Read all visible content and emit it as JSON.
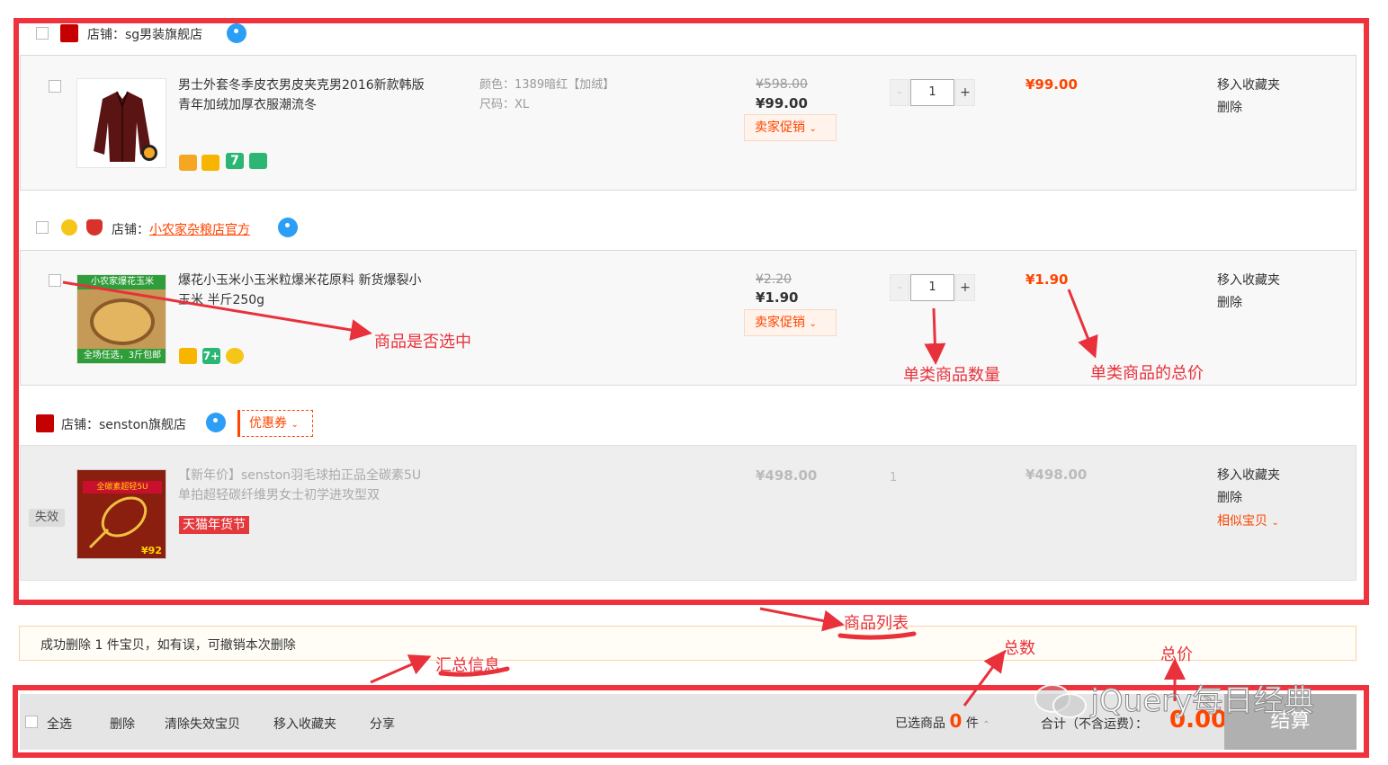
{
  "shops": [
    {
      "label": "店铺：",
      "name": "sg男装旗舰店",
      "items": [
        {
          "title": "男士外套冬季皮衣男皮夹克男2016新款韩版青年加绒加厚衣服潮流冬",
          "sku_color": "颜色：1389暗红【加绒】",
          "sku_size": "尺码：XL",
          "orig_price": "¥598.00",
          "price": "¥99.00",
          "promo": "卖家促销",
          "qty": "1",
          "minus": "-",
          "plus": "+",
          "sum": "¥99.00",
          "op_fav": "移入收藏夹",
          "op_del": "删除"
        }
      ]
    },
    {
      "label": "店铺：",
      "name": "小农家杂粮店官方",
      "items": [
        {
          "title": "爆花小玉米小玉米粒爆米花原料 新货爆裂小玉米 半斤250g",
          "thumb_top_text": "小农家爆花玉米",
          "thumb_bottom_text": "全场任选，3斤包邮",
          "orig_price": "¥2.20",
          "price": "¥1.90",
          "promo": "卖家促销",
          "qty": "1",
          "minus": "-",
          "plus": "+",
          "sum": "¥1.90",
          "op_fav": "移入收藏夹",
          "op_del": "删除"
        }
      ]
    },
    {
      "label": "店铺：",
      "name": "senston旗舰店",
      "coupon": "优惠券",
      "items": [
        {
          "invalid_tag": "失效",
          "title": "【新年价】senston羽毛球拍正品全碳素5U单拍超轻碳纤维男女士初学进攻型双",
          "badge": "天猫年货节",
          "thumb_text_1": "全碳素超轻5U",
          "thumb_price": "¥92",
          "price": "¥498.00",
          "qty": "1",
          "sum": "¥498.00",
          "op_fav": "移入收藏夹",
          "op_del": "删除",
          "op_similar": "相似宝贝"
        }
      ]
    }
  ],
  "notice": "成功删除 1 件宝贝，如有误，可撤销本次删除",
  "footer": {
    "select_all": "全选",
    "delete": "删除",
    "clear_invalid": "清除失效宝贝",
    "move_fav": "移入收藏夹",
    "share": "分享",
    "selected_label": "已选商品",
    "selected_count": "0",
    "selected_unit": "件",
    "total_label": "合计（不含运费）：",
    "total_value": "0.00",
    "checkout": "结算"
  },
  "annotations": {
    "selected": "商品是否选中",
    "quantity": "单类商品数量",
    "subtotal": "单类商品的总价",
    "list": "商品列表",
    "summary": "汇总信息",
    "count": "总数",
    "total": "总价"
  },
  "watermark": "jQuery每日经典",
  "colors": {
    "accent": "#ff4400",
    "annotation": "#e8313b",
    "frame": "#f0323c"
  }
}
